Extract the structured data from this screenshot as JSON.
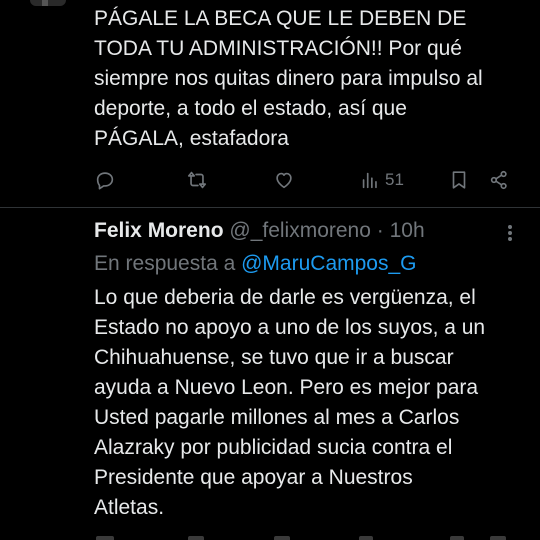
{
  "tweet1": {
    "text": "PÁGALE LA BECA QUE LE DEBEN DE\nTODA TU ADMINISTRACIÓN!! Por qué\nsiempre nos quitas dinero para impulso al\ndeporte, a todo el estado, así que\nPÁGALA, estafadora",
    "actions": {
      "reply_icon": "reply-icon",
      "retweet_icon": "retweet-icon",
      "like_icon": "heart-icon",
      "views_icon": "views-chart-icon",
      "views_count": "51",
      "bookmark_icon": "bookmark-icon",
      "share_icon": "share-icon"
    }
  },
  "tweet2": {
    "display_name": "Felix Moreno",
    "handle": "@_felixmoreno",
    "separator": "·",
    "time": "10h",
    "reply_prefix": "En respuesta a",
    "reply_to": "@MaruCampos_G",
    "text": "Lo que deberia de darle es vergüenza, el\nEstado no apoyo a uno de los suyos, a un\nChihuahuense, se tuvo que ir a buscar\nayuda a Nuevo Leon. Pero es mejor para\nUsted pagarle millones al mes a Carlos\nAlazraky por publicidad sucia contra el\nPresidente que apoyar a Nuestros\nAtletas."
  },
  "colors": {
    "background": "#000000",
    "text": "#e7e9ea",
    "secondary": "#71767b",
    "link": "#1d9bf0",
    "divider": "#2f3336"
  }
}
